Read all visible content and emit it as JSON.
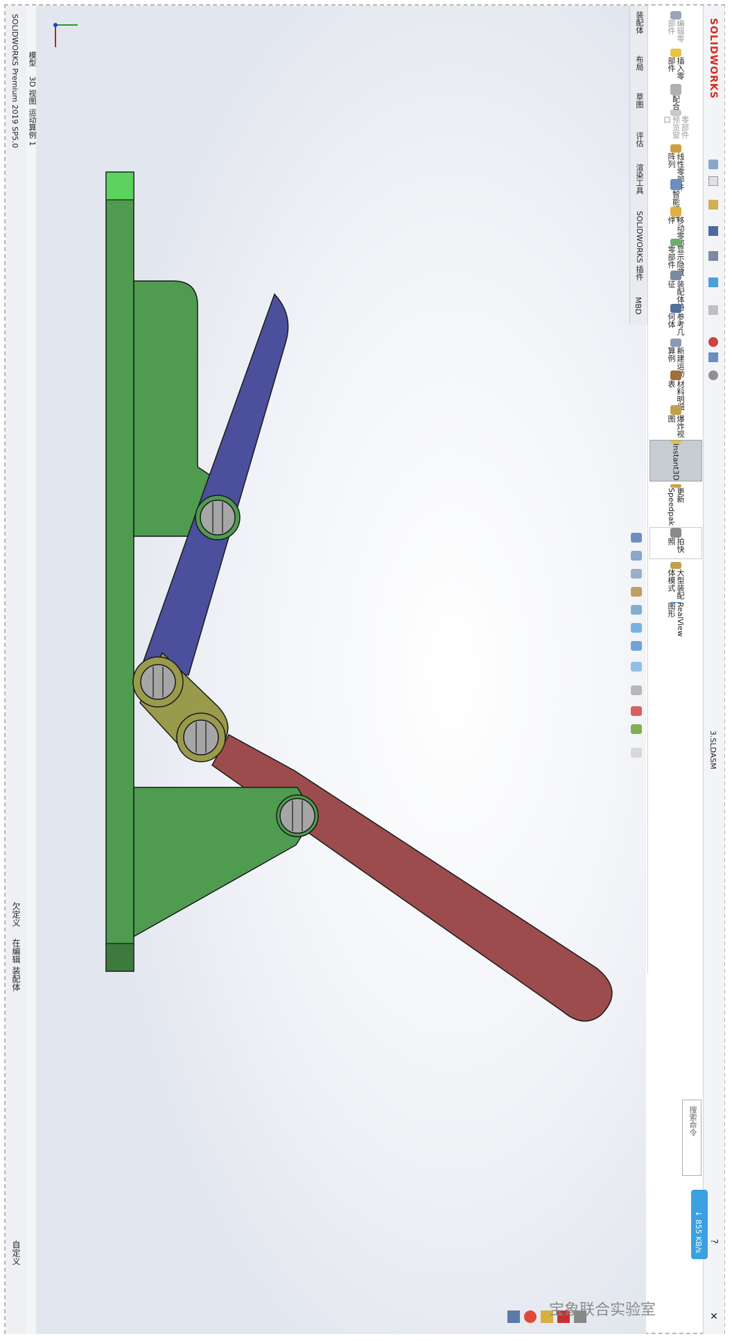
{
  "app": {
    "brand": "SOLIDWORKS",
    "title_bar": "SOLIDWORKS Premium 2019 SP5.0",
    "document": "3.SLDASM"
  },
  "feature_tabs": [
    "模型",
    "3D 视图",
    "运动算例 1"
  ],
  "status": {
    "under_defined": "欠定义",
    "editing": "在编辑 装配体",
    "custom": "自定义"
  },
  "command_tabs": [
    "装配体",
    "布局",
    "草图",
    "评估",
    "渲染工具",
    "SOLIDWORKS 插件",
    "MBD"
  ],
  "commands": [
    {
      "label": "编辑零部件",
      "icon": "edit-component-icon"
    },
    {
      "label": "插入零部件",
      "icon": "insert-component-icon"
    },
    {
      "label": "配合",
      "icon": "mate-icon"
    },
    {
      "label": "零部件预览窗口",
      "icon": "preview-window-icon"
    },
    {
      "label": "线性零部件阵列",
      "icon": "linear-pattern-icon"
    },
    {
      "label": "智能扣件",
      "icon": "smart-fasteners-icon"
    },
    {
      "label": "移动零部件",
      "icon": "move-component-icon"
    },
    {
      "label": "显示隐藏零部件",
      "icon": "show-hidden-icon"
    },
    {
      "label": "装配体特征",
      "icon": "assembly-features-icon"
    },
    {
      "label": "参考几何体",
      "icon": "reference-geometry-icon"
    },
    {
      "label": "新建运动算例",
      "icon": "new-motion-study-icon"
    },
    {
      "label": "材料明细表",
      "icon": "bom-icon"
    },
    {
      "label": "爆炸视图",
      "icon": "exploded-view-icon"
    },
    {
      "label": "Instant3D",
      "icon": "instant3d-icon",
      "selected": true
    },
    {
      "label": "更新 Speedpak",
      "icon": "speedpak-icon"
    },
    {
      "label": "拍快照",
      "icon": "snapshot-icon"
    },
    {
      "label": "大型装配体模式",
      "icon": "large-assembly-icon"
    },
    {
      "label": "RealView 图形",
      "icon": "realview-icon"
    }
  ],
  "search": {
    "placeholder": "搜索命令"
  },
  "network": {
    "speed": "↓ 855 KB/s"
  },
  "watermark": "宝象联合实验室",
  "colors": {
    "frame_green": "#4f9b4f",
    "link_blue": "#4c4f9c",
    "link_olive": "#9a9a4c",
    "link_red": "#9c4c4c",
    "pin_gray": "#a6a6a6",
    "brand_red": "#d52b1e"
  }
}
